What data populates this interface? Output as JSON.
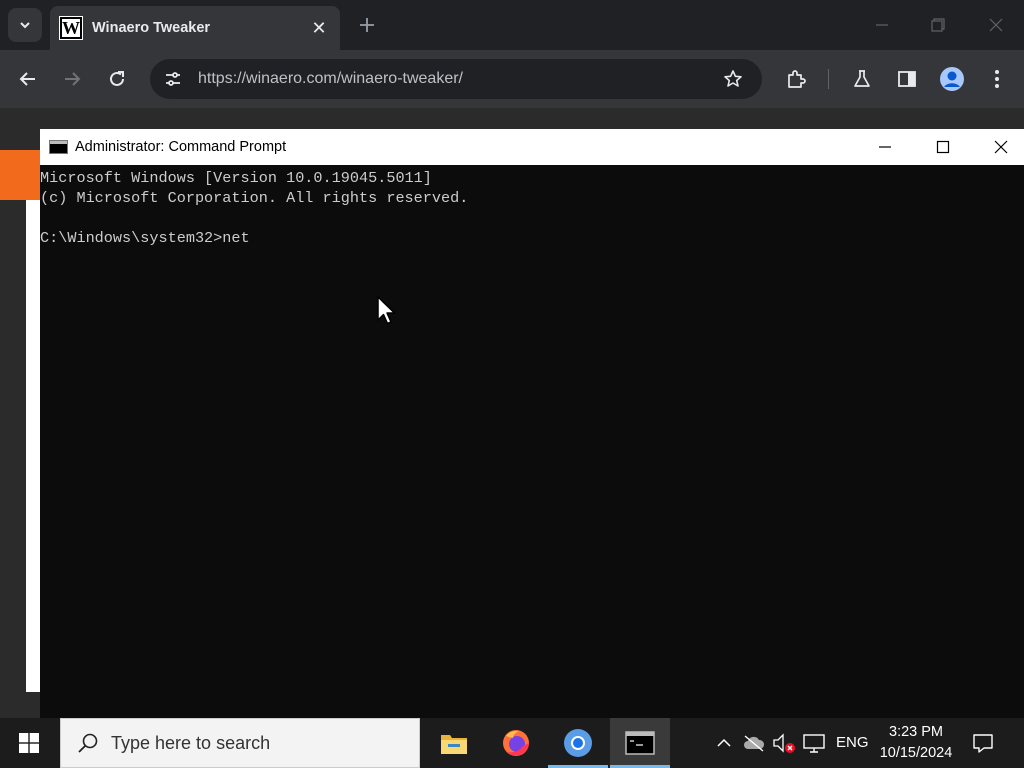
{
  "browser": {
    "tab_title": "Winaero Tweaker",
    "favicon_letter": "W",
    "tab_close": "✕",
    "url": "https://winaero.com/winaero-tweaker/",
    "icons": [
      "chevron-down-icon",
      "close-icon",
      "plus-icon",
      "minimize-icon",
      "restore-icon",
      "back-icon",
      "forward-icon",
      "reload-icon",
      "site-settings-icon",
      "star-icon",
      "extensions-icon",
      "labs-icon",
      "side-panel-icon",
      "profile-icon",
      "menu-icon"
    ],
    "accent_color": "#f26b1d"
  },
  "cmd": {
    "title": "Administrator: Command Prompt",
    "lines": [
      "Microsoft Windows [Version 10.0.19045.5011]",
      "(c) Microsoft Corporation. All rights reserved.",
      "",
      "C:\\Windows\\system32>net"
    ],
    "text_color": "#cccccc",
    "background": "#0c0c0c"
  },
  "taskbar": {
    "search_placeholder": "Type here to search",
    "apps": [
      "file-explorer-icon",
      "firefox-icon",
      "chrome-icon",
      "cmd-icon"
    ],
    "active_app": "cmd-icon",
    "tray_icons": [
      "chevron-up-icon",
      "cloud-offline-icon",
      "volume-muted-icon",
      "network-icon"
    ],
    "language": "ENG",
    "time": "3:23 PM",
    "date": "10/15/2024"
  }
}
